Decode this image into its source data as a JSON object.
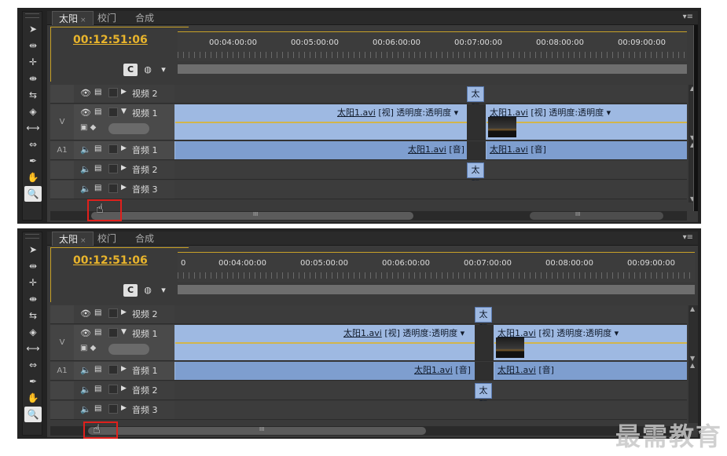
{
  "tabs": [
    {
      "label": "太阳",
      "close": "×"
    },
    {
      "label": "校门"
    },
    {
      "label": "合成"
    }
  ],
  "panel_menu": "▾≡",
  "timecode": "00:12:51:06",
  "ruler_labels_1": [
    "00:04:00:00",
    "00:05:00:00",
    "00:06:00:00",
    "00:07:00:00",
    "00:08:00:00",
    "00:09:00:00"
  ],
  "ruler_labels_2": [
    "0",
    "00:04:00:00",
    "00:05:00:00",
    "00:06:00:00",
    "00:07:00:00",
    "00:08:00:00",
    "00:09:00:00"
  ],
  "tracks": {
    "video2": "视频 2",
    "video1": "视频 1",
    "audio1": "音频 1",
    "audio2": "音频 2",
    "audio3": "音频 3",
    "v_label": "V",
    "a1_label": "A1"
  },
  "clips": {
    "video_name": "太阳",
    "video_ext": "1.avi",
    "video_tag": "[视]",
    "opacity": "透明度:透明度",
    "audio_name": "太阳",
    "audio_ext": "1.avi",
    "audio_tag": "[音]",
    "transition": "太阳"
  },
  "scroll_mark": "III",
  "watermark": "最需教育"
}
